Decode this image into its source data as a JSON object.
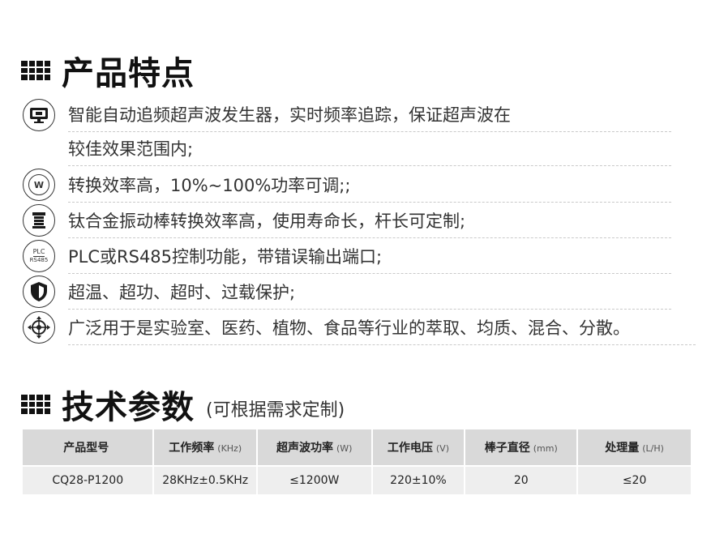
{
  "features_section": {
    "title": "产品特点",
    "items": [
      {
        "icon": "monitor-icon",
        "lines": [
          "智能自动追频超声波发生器，实时频率追踪，保证超声波在",
          "较佳效果范围内;"
        ]
      },
      {
        "icon": "w-circle-icon",
        "icon_text": "W",
        "lines": [
          "转换效率高，10%~100%功率可调;;"
        ]
      },
      {
        "icon": "rod-icon",
        "lines": [
          "钛合金振动棒转换效率高，使用寿命长，杆长可定制;"
        ]
      },
      {
        "icon": "plc-icon",
        "icon_text_top": "PLC",
        "icon_text_bottom": "RS485",
        "lines": [
          "PLC或RS485控制功能，带错误输出端口;"
        ]
      },
      {
        "icon": "shield-icon",
        "lines": [
          "超温、超功、超时、过载保护;"
        ]
      },
      {
        "icon": "crosshair-icon",
        "lines": [
          "广泛用于是实验室、医药、植物、食品等行业的萃取、均质、混合、分散。"
        ]
      }
    ]
  },
  "params_section": {
    "title": "技术参数",
    "subtitle": "(可根据需求定制)",
    "table": {
      "headers": [
        {
          "label": "产品型号",
          "unit": ""
        },
        {
          "label": "工作频率",
          "unit": "(KHz)"
        },
        {
          "label": "超声波功率",
          "unit": "(W)"
        },
        {
          "label": "工作电压",
          "unit": "(V)"
        },
        {
          "label": "棒子直径",
          "unit": "(mm)"
        },
        {
          "label": "处理量",
          "unit": "(L/H)"
        }
      ],
      "rows": [
        [
          "CQ28-P1200",
          "28KHz±0.5KHz",
          "≤1200W",
          "220±10%",
          "20",
          "≤20"
        ]
      ]
    }
  }
}
